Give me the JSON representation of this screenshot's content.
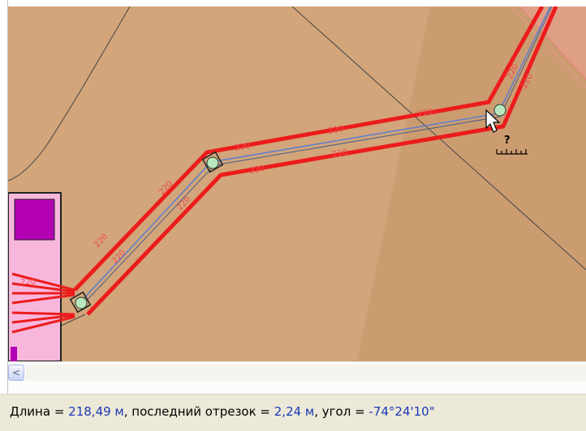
{
  "colors": {
    "map_background": "#d2a57a",
    "route_red": "#ec1c1c",
    "route_center": "#5a7fd0",
    "value_blue": "#1b38b4"
  },
  "map": {
    "route_labels": [
      "220",
      "220",
      "220",
      "220",
      "220",
      "220",
      "220",
      "220",
      "220",
      "220",
      "220",
      "220"
    ],
    "cursor_icon": "measure-help-cursor-icon",
    "cursor_glyph": "?"
  },
  "scrollbar": {
    "left_arrow_glyph": "<"
  },
  "status": {
    "length_label": "Длина = ",
    "length_value": "218,49 м",
    "segment_label": ", последний отрезок = ",
    "segment_value": "2,24 м",
    "angle_label": ", угол = ",
    "angle_value": "-74°24'10\""
  }
}
